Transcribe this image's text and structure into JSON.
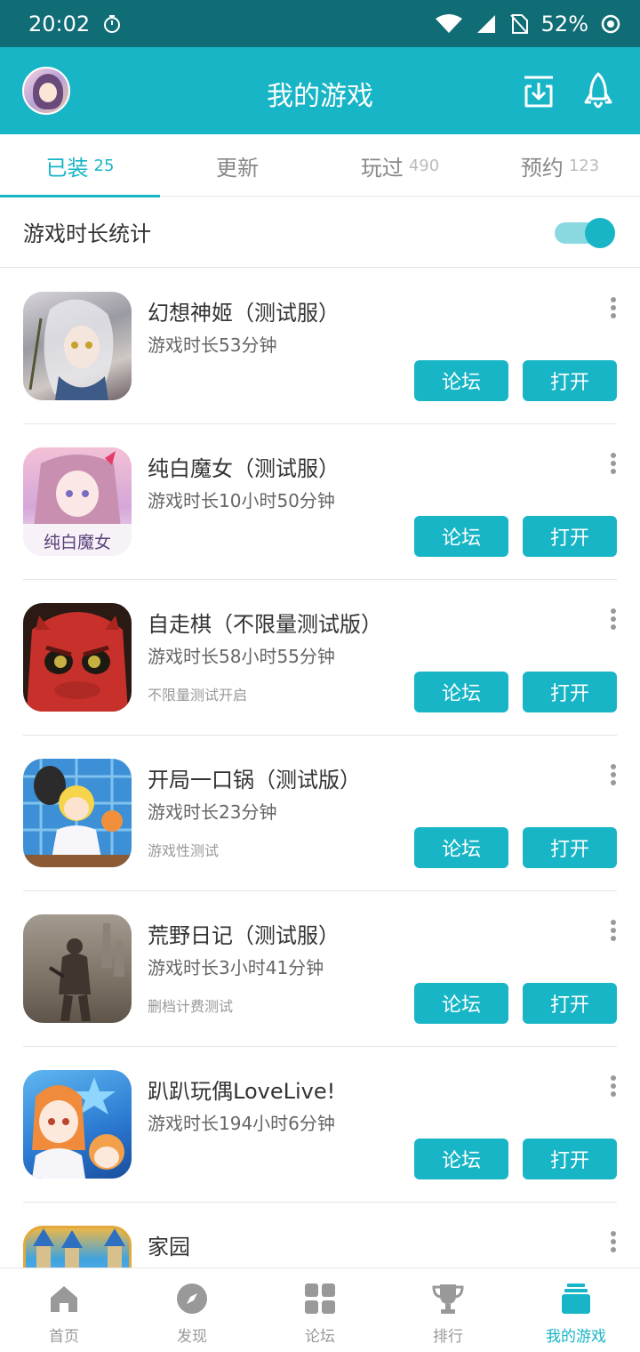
{
  "status_bar": {
    "time": "20:02",
    "battery": "52%"
  },
  "header": {
    "title": "我的游戏"
  },
  "tabs": [
    {
      "label": "已装",
      "count": "25",
      "active": true
    },
    {
      "label": "更新",
      "count": "",
      "active": false
    },
    {
      "label": "玩过",
      "count": "490",
      "active": false
    },
    {
      "label": "预约",
      "count": "123",
      "active": false
    }
  ],
  "stats": {
    "label": "游戏时长统计",
    "enabled": true
  },
  "games": [
    {
      "name": "幻想神姬（测试服）",
      "time": "游戏时长53分钟",
      "note": "",
      "forum_label": "论坛",
      "open_label": "打开"
    },
    {
      "name": "纯白魔女（测试服）",
      "time": "游戏时长10小时50分钟",
      "note": "",
      "forum_label": "论坛",
      "open_label": "打开",
      "icon_text": "纯白魔女"
    },
    {
      "name": "自走棋（不限量测试版）",
      "time": "游戏时长58小时55分钟",
      "note": "不限量测试开启",
      "forum_label": "论坛",
      "open_label": "打开"
    },
    {
      "name": "开局一口锅（测试版）",
      "time": "游戏时长23分钟",
      "note": "游戏性测试",
      "forum_label": "论坛",
      "open_label": "打开"
    },
    {
      "name": "荒野日记（测试服）",
      "time": "游戏时长3小时41分钟",
      "note": "删档计费测试",
      "forum_label": "论坛",
      "open_label": "打开"
    },
    {
      "name": "趴趴玩偶LoveLive!",
      "time": "游戏时长194小时6分钟",
      "note": "",
      "forum_label": "论坛",
      "open_label": "打开"
    },
    {
      "name": "家园",
      "time": "",
      "note": "",
      "forum_label": "",
      "open_label": ""
    }
  ],
  "bottom_nav": [
    {
      "label": "首页",
      "icon": "home-icon",
      "active": false
    },
    {
      "label": "发现",
      "icon": "compass-icon",
      "active": false
    },
    {
      "label": "论坛",
      "icon": "grid-icon",
      "active": false
    },
    {
      "label": "排行",
      "icon": "trophy-icon",
      "active": false
    },
    {
      "label": "我的游戏",
      "icon": "my-games-icon",
      "active": true
    }
  ],
  "colors": {
    "accent": "#17b5c6",
    "status_bar": "#116d75"
  }
}
